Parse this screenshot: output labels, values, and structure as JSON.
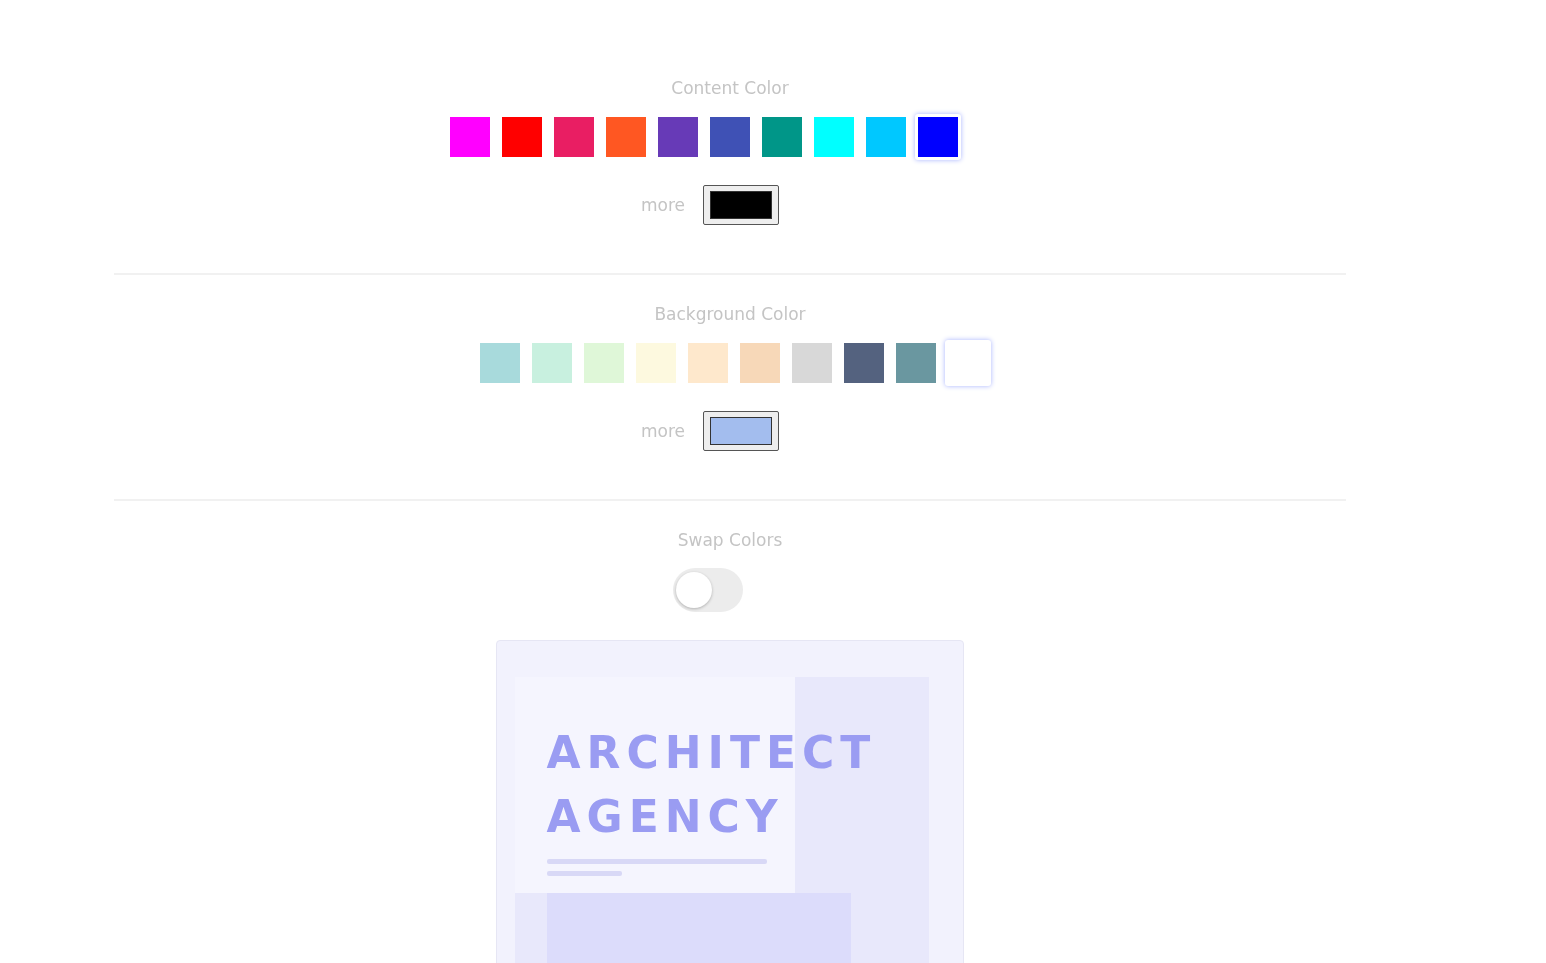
{
  "sections": [
    {
      "title": "Content Color",
      "swatches": [
        {
          "color": "#ff00ff",
          "selected": false
        },
        {
          "color": "#ff0000",
          "selected": false
        },
        {
          "color": "#e91e63",
          "selected": false
        },
        {
          "color": "#ff5722",
          "selected": false
        },
        {
          "color": "#673ab7",
          "selected": false
        },
        {
          "color": "#3f51b5",
          "selected": false
        },
        {
          "color": "#009688",
          "selected": false
        },
        {
          "color": "#00ffff",
          "selected": false
        },
        {
          "color": "#00c8ff",
          "selected": false
        },
        {
          "color": "#0000ff",
          "selected": true
        }
      ],
      "more_label": "more",
      "custom": {
        "color": "#000000"
      }
    },
    {
      "title": "Background Color",
      "swatches": [
        {
          "color": "#a8dadc",
          "selected": false
        },
        {
          "color": "#c8f0df",
          "selected": false
        },
        {
          "color": "#dff7d8",
          "selected": false
        },
        {
          "color": "#fdf9df",
          "selected": false
        },
        {
          "color": "#fee8cc",
          "selected": false
        },
        {
          "color": "#f7d8b8",
          "selected": false
        },
        {
          "color": "#d8d8d8",
          "selected": false
        },
        {
          "color": "#54627f",
          "selected": false
        },
        {
          "color": "#6a97a0",
          "selected": false
        },
        {
          "color": "#ffffff",
          "selected": true
        }
      ],
      "more_label": "more",
      "custom": {
        "color": "#a3bdee"
      }
    }
  ],
  "swap": {
    "title": "Swap Colors",
    "on": false
  },
  "preview": {
    "title_lines": [
      "ARCHITECT",
      "AGENCY"
    ]
  }
}
